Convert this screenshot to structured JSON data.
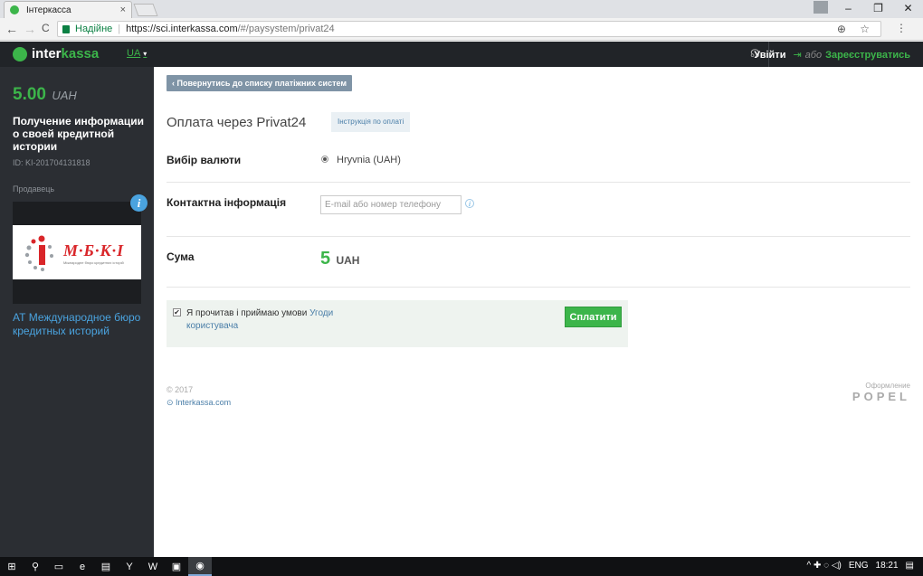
{
  "browser": {
    "tab_title": "Інтеркасса",
    "tab_close": "×",
    "window_buttons": [
      "–",
      "❐",
      "✕"
    ],
    "nav_buttons": [
      "←",
      "→",
      "C"
    ],
    "secure_label": "Надійне",
    "url_host": "https://sci.interkassa.com",
    "url_path": "/#/paysystem/privat24",
    "omni_icons": "⊕ ☆"
  },
  "header": {
    "logo_a": "inter",
    "logo_b": "kassa",
    "lang": "UA",
    "lang_caret": "▾",
    "support_icon": "headset-icon",
    "login": "Увійти",
    "login_icon": "⇥",
    "or": "або",
    "register": "Зареєструватись"
  },
  "sidebar": {
    "amount": "5.00",
    "currency": "UAH",
    "order_title": "Получение информации о своей кредитной истории",
    "order_id": "ID: KI-201704131818",
    "seller_label": "Продавець",
    "seller_logo_text": "М·Б·К·І",
    "seller_logo_sub": "Міжнародне бюро кредитних історій",
    "info_badge": "i",
    "seller_name": "АТ Международное бюро кредитных историй"
  },
  "main": {
    "back_button": "‹  Повернутись до списку платіжних систем",
    "title": "Оплата через Privat24",
    "instruction_button": "Інструкція по оплаті",
    "currency_label": "Вибір валюти",
    "currency_value": "Hryvnia (UAH)",
    "contact_label": "Контактна інформація",
    "contact_placeholder": "E-mail або номер телефону",
    "contact_info_icon": "i",
    "sum_label": "Сума",
    "sum_value": "5",
    "sum_currency": "UAH",
    "agree_check": "✔",
    "agree_text": "Я прочитав і приймаю умови",
    "agree_link": "Угоди користувача",
    "pay_button": "Сплатити"
  },
  "footer": {
    "copyright": "© 2017",
    "link": "Interkassa.com",
    "designer_label": "Оформление",
    "designer_name": "POPEL"
  },
  "taskbar": {
    "icons": [
      "⊞",
      "⚲",
      "▭",
      "e",
      "▤",
      "Y",
      "W",
      "▣",
      "◉"
    ],
    "tray_icons": "^ ✚ ◌ ◁)",
    "lang": "ENG",
    "time": "18:21",
    "notif_icon": "▤"
  },
  "colors": {
    "accent_green": "#3cb54a",
    "sidebar_bg": "#2b2e33",
    "header_bg": "#212428",
    "link_blue": "#4aa3df"
  }
}
